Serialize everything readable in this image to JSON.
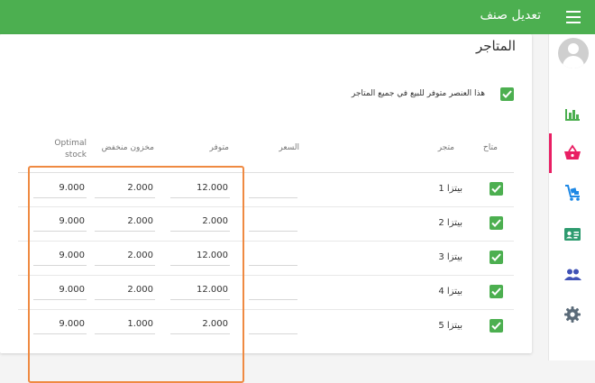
{
  "topbar": {
    "title": "تعديل صنف",
    "menu_icon": "menu-icon",
    "color": "#4caf50"
  },
  "sidebar": {
    "icons": [
      "avatar",
      "bar-chart-icon",
      "basket-icon",
      "trolley-icon",
      "contact-card-icon",
      "people-icon",
      "gear-icon"
    ],
    "active": "basket-icon",
    "active_color": "#e91e63"
  },
  "stores": {
    "title": "المتاجر",
    "available_all_label": "هذا العنصر متوفر للبيع في جميع المتاجر",
    "available_all_checked": true,
    "headers": {
      "available": "متاح",
      "store": "متجر",
      "price": "السعر",
      "in_stock": "متوفر",
      "low_stock": "مخزون منخفض",
      "optimal_stock": "Optimal stock"
    },
    "rows": [
      {
        "available": true,
        "store": "بيتزا 1",
        "price": "",
        "in_stock": "12.000",
        "low_stock": "2.000",
        "optimal_stock": "9.000"
      },
      {
        "available": true,
        "store": "بيتزا 2",
        "price": "",
        "in_stock": "2.000",
        "low_stock": "2.000",
        "optimal_stock": "9.000"
      },
      {
        "available": true,
        "store": "بيتزا 3",
        "price": "",
        "in_stock": "12.000",
        "low_stock": "2.000",
        "optimal_stock": "9.000"
      },
      {
        "available": true,
        "store": "بيتزا 4",
        "price": "",
        "in_stock": "12.000",
        "low_stock": "2.000",
        "optimal_stock": "9.000"
      },
      {
        "available": true,
        "store": "بيتزا 5",
        "price": "",
        "in_stock": "2.000",
        "low_stock": "1.000",
        "optimal_stock": "9.000"
      }
    ]
  },
  "highlight_color": "#ef8a42"
}
